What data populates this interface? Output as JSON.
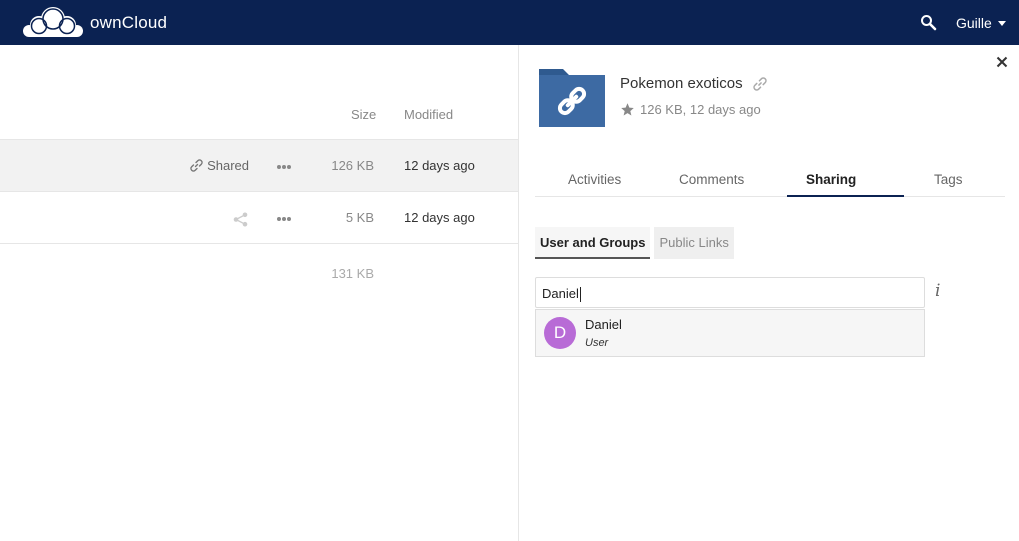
{
  "header": {
    "app_name": "ownCloud",
    "user": "Guille",
    "logo_icon": "cloud-logo-icon",
    "search_icon": "search-icon",
    "bg_color": "#0b2252"
  },
  "file_list": {
    "columns": {
      "size": "Size",
      "modified": "Modified"
    },
    "rows": [
      {
        "share_label": "Shared",
        "size": "126 KB",
        "modified": "12 days ago",
        "selected": true
      },
      {
        "share_label": "",
        "size": "5 KB",
        "modified": "12 days ago",
        "selected": false
      }
    ],
    "total_size": "131 KB"
  },
  "sidebar": {
    "file_name": "Pokemon exoticos",
    "file_meta": "126 KB, 12 days ago",
    "tabs": [
      "Activities",
      "Comments",
      "Sharing",
      "Tags"
    ],
    "active_tab": "Sharing",
    "subtabs": [
      "User and Groups",
      "Public Links"
    ],
    "share_input_value": "Daniel",
    "autocomplete": {
      "initial": "D",
      "name": "Daniel",
      "type": "User",
      "avatar_color": "#b86bd6"
    },
    "info_glyph": "i"
  }
}
